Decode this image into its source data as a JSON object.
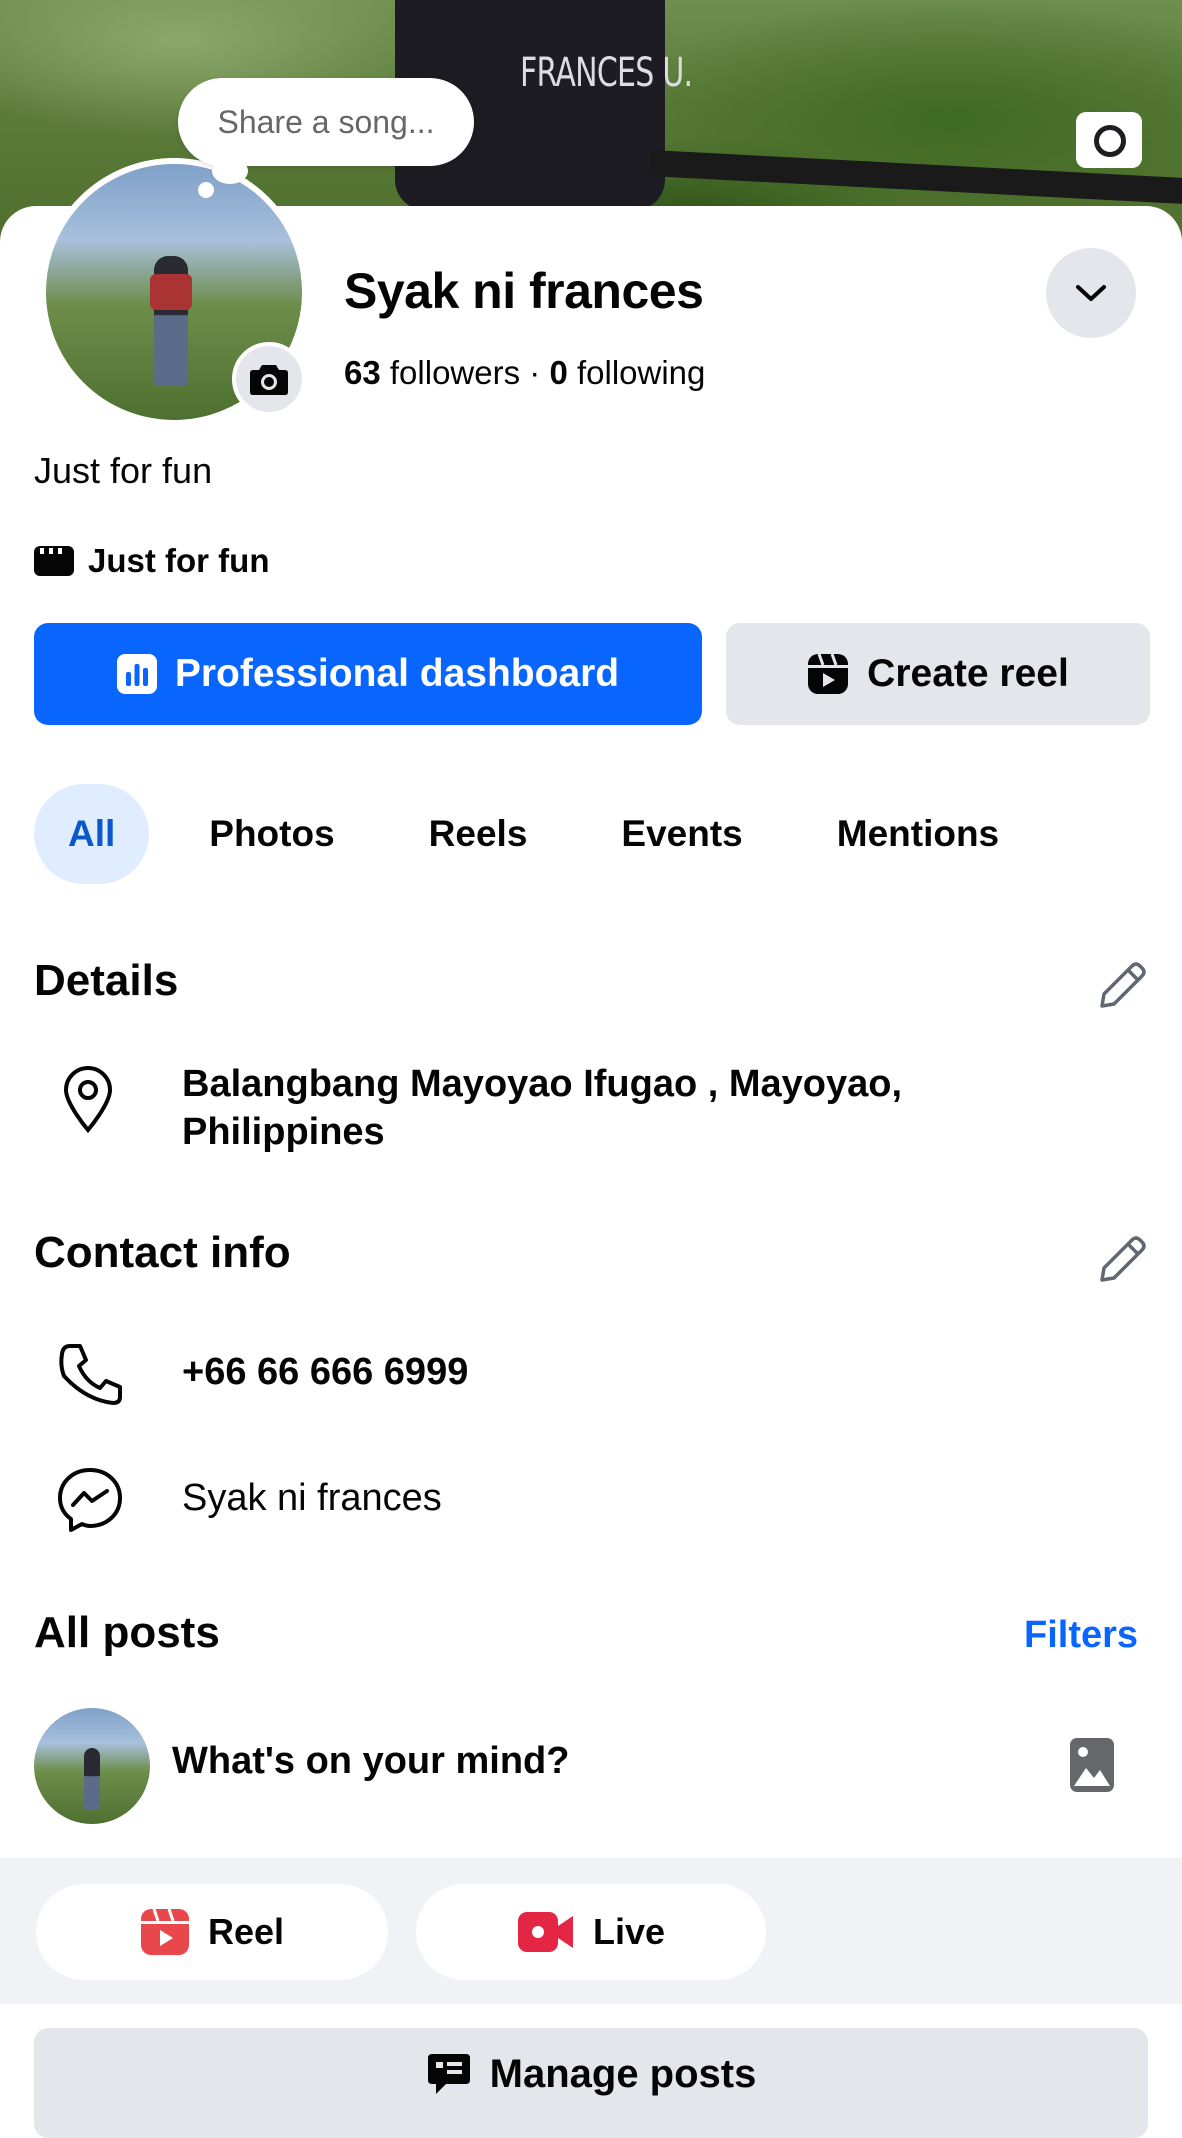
{
  "profile": {
    "song_prompt": "Share a song...",
    "name": "Syak ni frances",
    "followers_count": "63",
    "followers_label": "followers",
    "following_count": "0",
    "following_label": "following",
    "bio": "Just for fun",
    "category": "Just for fun",
    "cover_jersey_text": "FRANCES U."
  },
  "actions": {
    "professional_dashboard": "Professional dashboard",
    "create_reel": "Create reel"
  },
  "tabs": [
    {
      "label": "All",
      "active": true
    },
    {
      "label": "Photos",
      "active": false
    },
    {
      "label": "Reels",
      "active": false
    },
    {
      "label": "Events",
      "active": false
    },
    {
      "label": "Mentions",
      "active": false
    }
  ],
  "details": {
    "title": "Details",
    "location_line1": "Balangbang Mayoyao Ifugao , Mayoyao,",
    "location_line2": "Philippines"
  },
  "contact": {
    "title": "Contact info",
    "phone": "+66 66 666 6999",
    "messenger": "Syak ni frances"
  },
  "posts": {
    "title": "All posts",
    "filters": "Filters",
    "composer_placeholder": "What's on your mind?",
    "reel_label": "Reel",
    "live_label": "Live",
    "manage_posts": "Manage posts"
  },
  "colors": {
    "accent_blue": "#0866ff",
    "tab_active_bg": "#e0ecff",
    "reel_red": "#e8474c",
    "live_red": "#e42645"
  }
}
